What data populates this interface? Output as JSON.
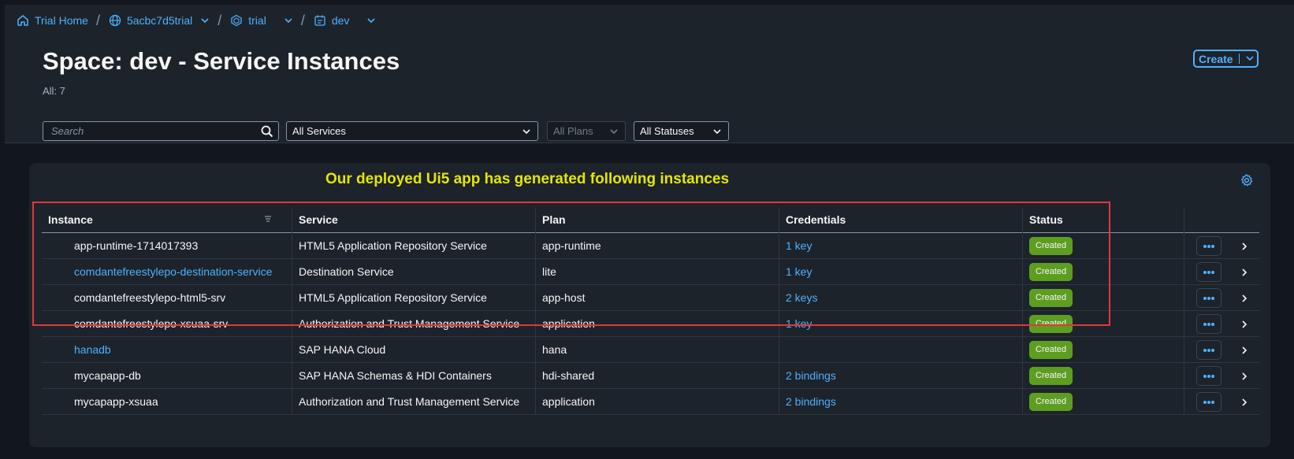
{
  "breadcrumb": [
    {
      "label": "Trial Home",
      "icon": "home-icon",
      "dropdown": false
    },
    {
      "label": "5acbc7d5trial",
      "icon": "globe-icon",
      "dropdown": true
    },
    {
      "label": "trial",
      "icon": "subaccount-icon",
      "dropdown": true
    },
    {
      "label": "dev",
      "icon": "space-icon",
      "dropdown": true
    }
  ],
  "header": {
    "title": "Space: dev - Service Instances",
    "count": "All: 7",
    "create_label": "Create"
  },
  "filters": {
    "search_placeholder": "Search",
    "services": "All Services",
    "plans": "All Plans",
    "statuses": "All Statuses"
  },
  "annotation": "Our deployed Ui5 app has generated following instances",
  "table": {
    "columns": [
      "Instance",
      "Service",
      "Plan",
      "Credentials",
      "Status"
    ],
    "rows": [
      {
        "instance": "app-runtime-1714017393",
        "instance_link": false,
        "service": "HTML5 Application Repository Service",
        "plan": "app-runtime",
        "credentials": "1 key",
        "status": "Created"
      },
      {
        "instance": "comdantefreestylepo-destination-service",
        "instance_link": true,
        "service": "Destination Service",
        "plan": "lite",
        "credentials": "1 key",
        "status": "Created"
      },
      {
        "instance": "comdantefreestylepo-html5-srv",
        "instance_link": false,
        "service": "HTML5 Application Repository Service",
        "plan": "app-host",
        "credentials": "2 keys",
        "status": "Created"
      },
      {
        "instance": "comdantefreestylepo-xsuaa-srv",
        "instance_link": false,
        "service": "Authorization and Trust Management Service",
        "plan": "application",
        "credentials": "1 key",
        "status": "Created"
      },
      {
        "instance": "hanadb",
        "instance_link": true,
        "service": "SAP HANA Cloud",
        "plan": "hana",
        "credentials": "",
        "status": "Created"
      },
      {
        "instance": "mycapapp-db",
        "instance_link": false,
        "service": "SAP HANA Schemas & HDI Containers",
        "plan": "hdi-shared",
        "credentials": "2 bindings",
        "status": "Created"
      },
      {
        "instance": "mycapapp-xsuaa",
        "instance_link": false,
        "service": "Authorization and Trust Management Service",
        "plan": "application",
        "credentials": "2 bindings",
        "status": "Created"
      }
    ]
  },
  "colors": {
    "accent": "#4db1ff",
    "status_created": "#5d9e21",
    "annotation": "#e6e600",
    "highlight_border": "#e0383b"
  }
}
